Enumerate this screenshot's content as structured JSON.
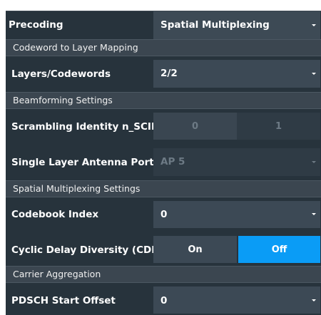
{
  "precoding": {
    "label": "Precoding",
    "value": "Spatial Multiplexing"
  },
  "sections": {
    "codeword_mapping": "Codeword to Layer Mapping",
    "beamforming": "Beamforming Settings",
    "spatial_mux": "Spatial Multiplexing Settings",
    "carrier_agg": "Carrier Aggregation"
  },
  "layers_codewords": {
    "label": "Layers/Codewords",
    "value": "2/2"
  },
  "scrambling": {
    "label": "Scrambling Identity n_SCID",
    "options": [
      "0",
      "1"
    ]
  },
  "antenna_port": {
    "label": "Single Layer Antenna Port",
    "value": "AP 5"
  },
  "codebook_index": {
    "label": "Codebook Index",
    "value": "0"
  },
  "cdd": {
    "label": "Cyclic Delay Diversity (CDD)",
    "on": "On",
    "off": "Off",
    "selected": "Off"
  },
  "pdsch_offset": {
    "label": "PDSCH Start Offset",
    "value": "0"
  },
  "colors": {
    "panel_bg": "#27333c",
    "section_bg": "#3b4650",
    "field_bg": "#3c4955",
    "accent": "#0a9cf6",
    "disabled_text": "#6d7a85"
  }
}
